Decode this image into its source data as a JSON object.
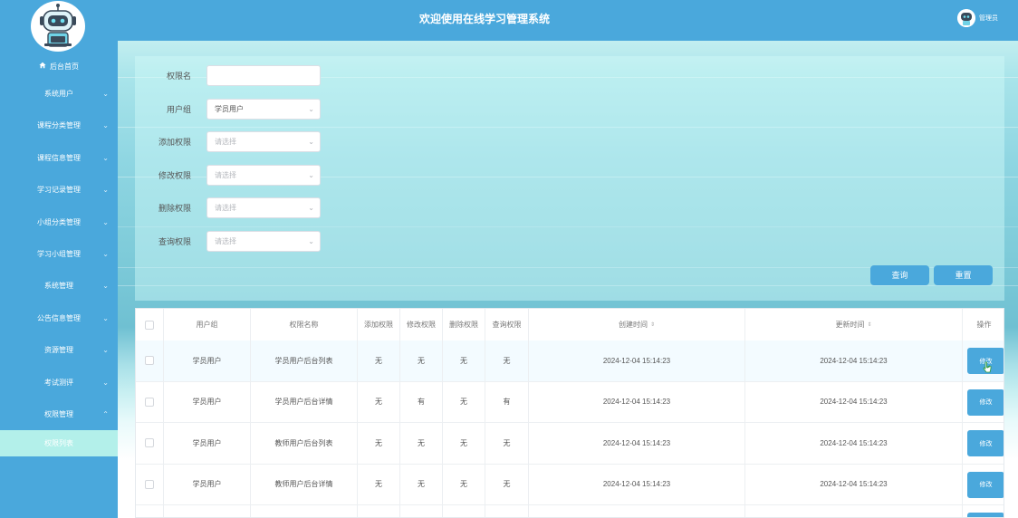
{
  "header": {
    "title": "欢迎使用在线学习管理系统",
    "user_label": "管理员"
  },
  "sidebar": {
    "home": "后台首页",
    "items": [
      {
        "label": "系统用户",
        "chevron": "⌄"
      },
      {
        "label": "课程分类管理",
        "chevron": "⌄"
      },
      {
        "label": "课程信息管理",
        "chevron": "⌄"
      },
      {
        "label": "学习记录管理",
        "chevron": "⌄"
      },
      {
        "label": "小组分类管理",
        "chevron": "⌄"
      },
      {
        "label": "学习小组管理",
        "chevron": "⌄"
      },
      {
        "label": "系统管理",
        "chevron": "⌄"
      },
      {
        "label": "公告信息管理",
        "chevron": "⌄"
      },
      {
        "label": "资源管理",
        "chevron": "⌄"
      },
      {
        "label": "考试测评",
        "chevron": "⌄"
      },
      {
        "label": "权限管理",
        "chevron": "⌃"
      }
    ],
    "active_sub": "权限列表"
  },
  "search": {
    "fields": [
      {
        "label": "权限名",
        "value": "",
        "select": false
      },
      {
        "label": "用户组",
        "value": "学员用户",
        "select": true
      },
      {
        "label": "添加权限",
        "value": "请选择",
        "select": true
      },
      {
        "label": "修改权限",
        "value": "请选择",
        "select": true
      },
      {
        "label": "删除权限",
        "value": "请选择",
        "select": true
      },
      {
        "label": "查询权限",
        "value": "请选择",
        "select": true
      }
    ],
    "query_button": "查询",
    "reset_button": "重置"
  },
  "table": {
    "headers": [
      "用户组",
      "权限名称",
      "添加权限",
      "修改权限",
      "删除权限",
      "查询权限",
      "创建时间",
      "更新时间",
      "操作"
    ],
    "sort_icon": "⇕",
    "edit_label": "修改",
    "rows": [
      [
        "学员用户",
        "学员用户后台列表",
        "无",
        "无",
        "无",
        "无",
        "2024-12-04 15:14:23",
        "2024-12-04 15:14:23"
      ],
      [
        "学员用户",
        "学员用户后台详情",
        "无",
        "有",
        "无",
        "有",
        "2024-12-04 15:14:23",
        "2024-12-04 15:14:23"
      ],
      [
        "学员用户",
        "教师用户后台列表",
        "无",
        "无",
        "无",
        "无",
        "2024-12-04 15:14:23",
        "2024-12-04 15:14:23"
      ],
      [
        "学员用户",
        "教师用户后台详情",
        "无",
        "无",
        "无",
        "无",
        "2024-12-04 15:14:23",
        "2024-12-04 15:14:23"
      ]
    ]
  }
}
